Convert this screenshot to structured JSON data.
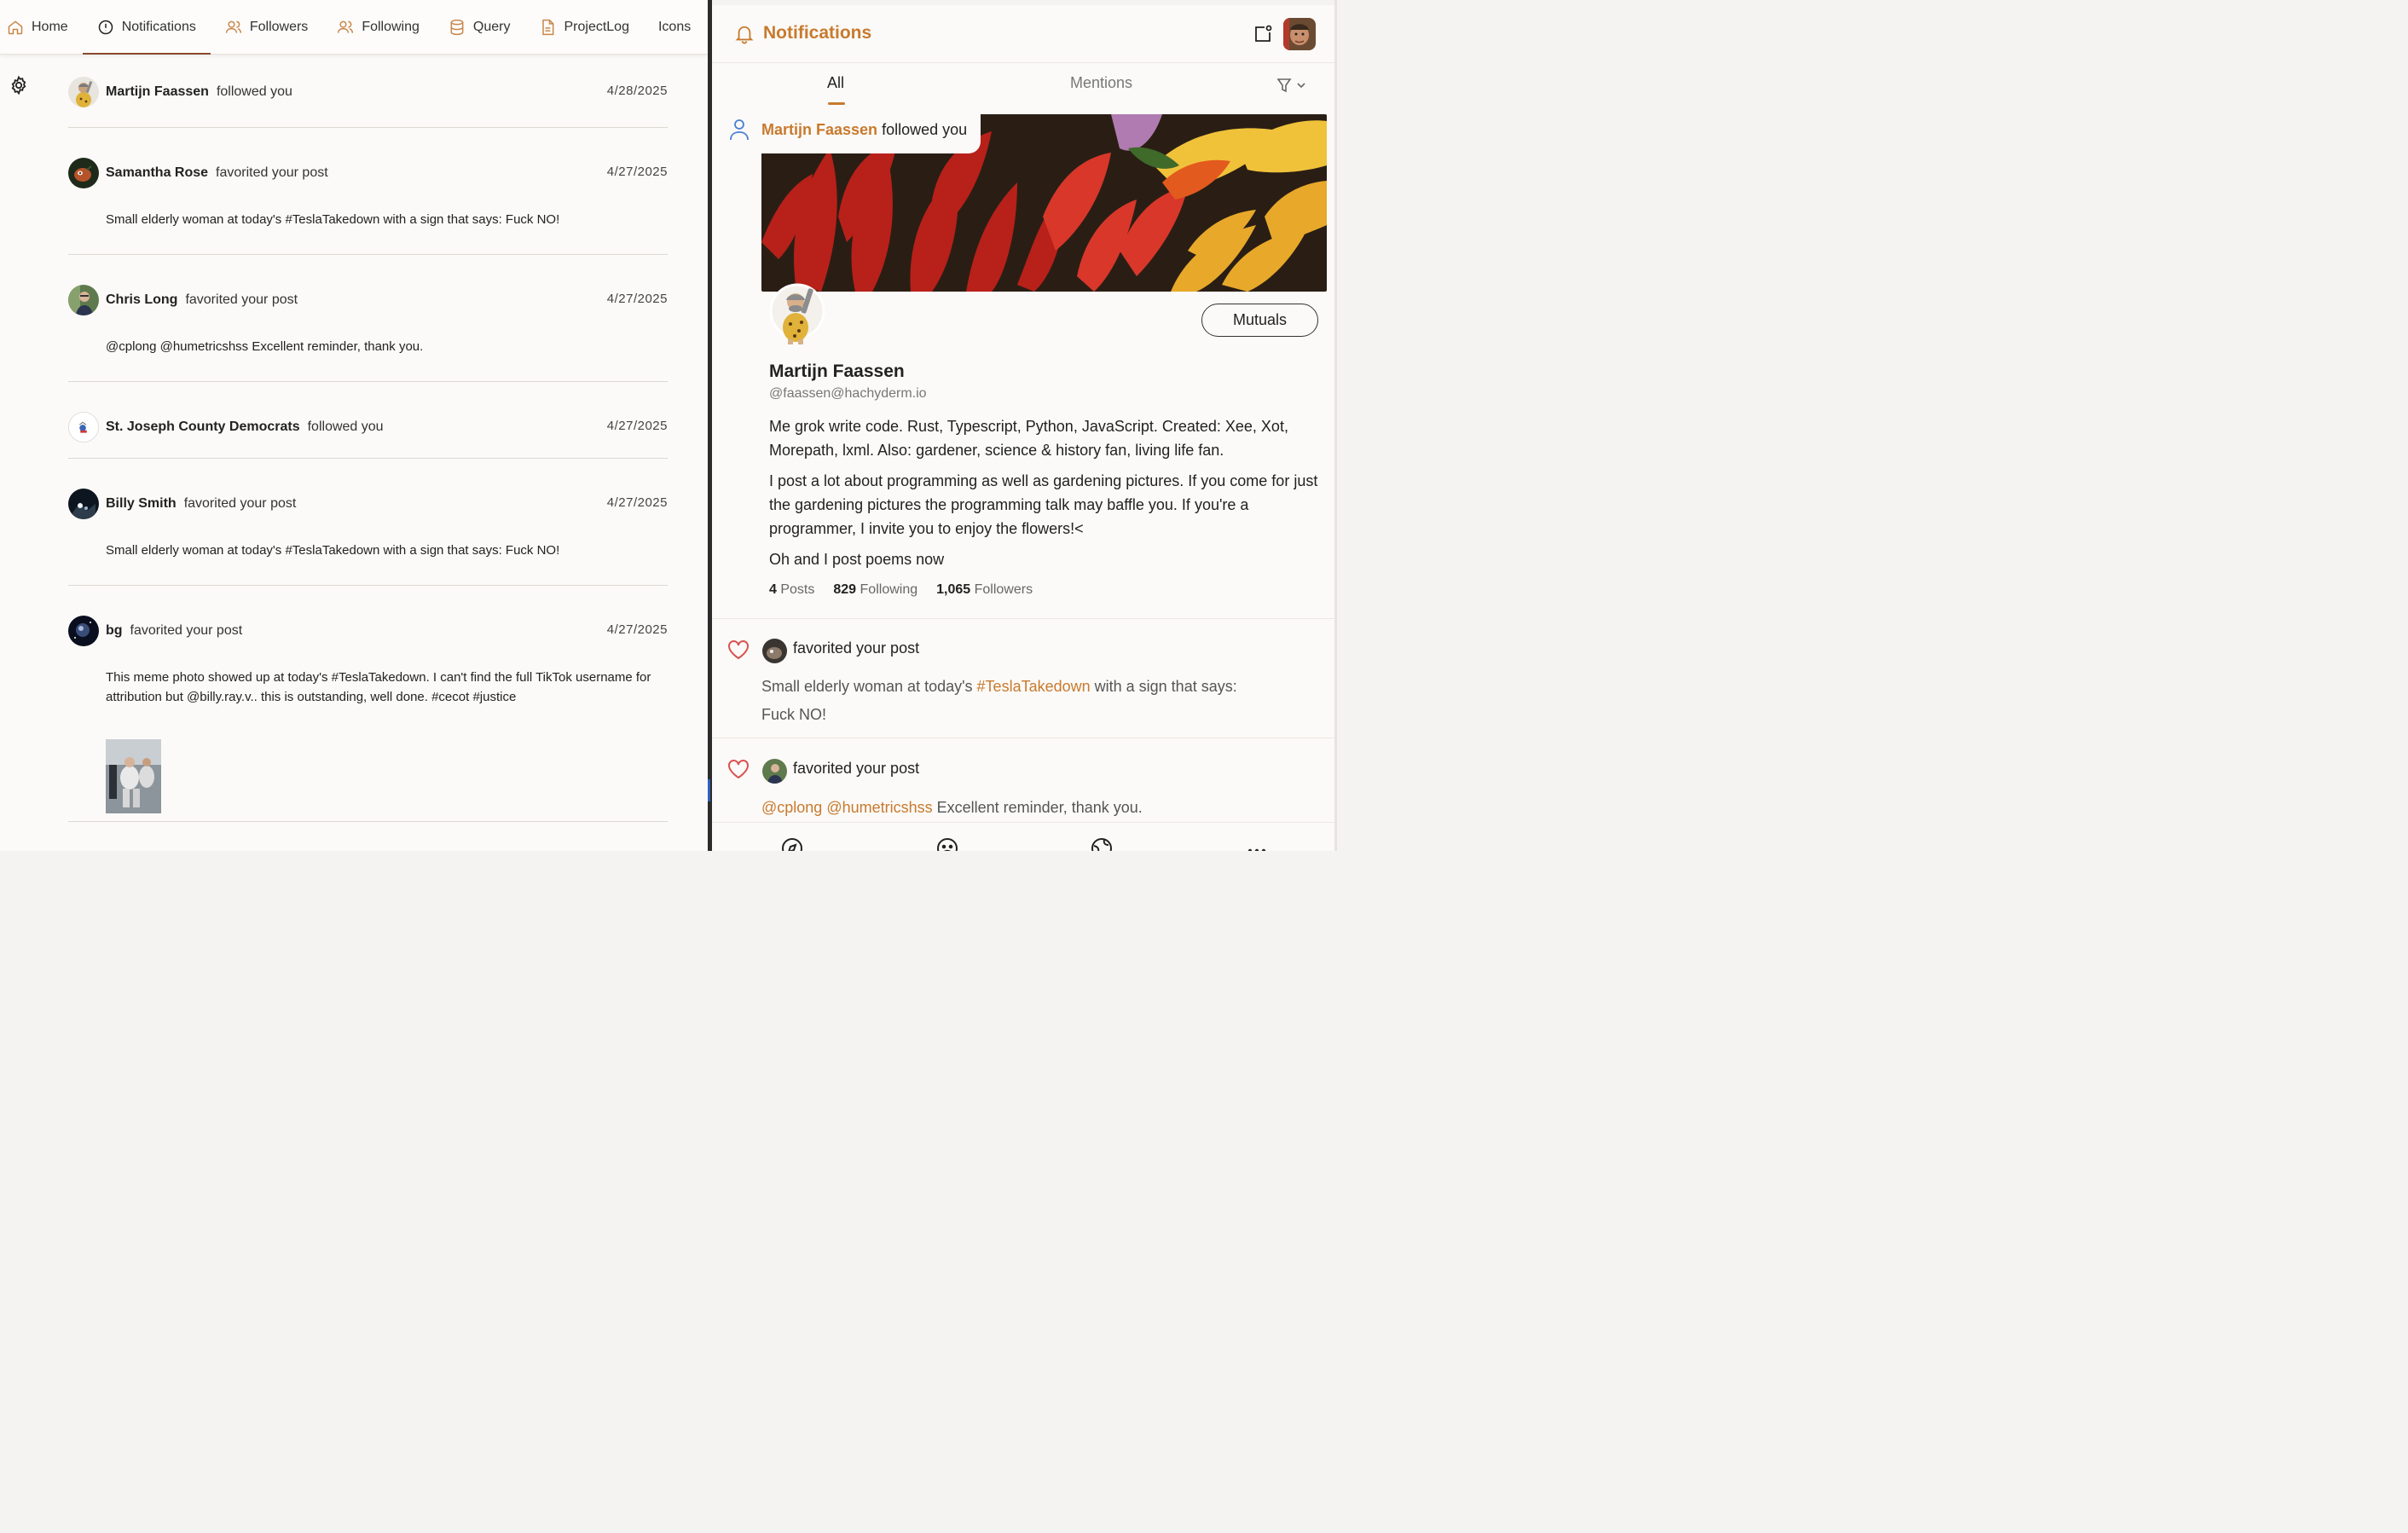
{
  "nav": {
    "tabs": [
      {
        "label": "Home",
        "icon": "home-icon"
      },
      {
        "label": "Notifications",
        "icon": "alert-circle-icon"
      },
      {
        "label": "Followers",
        "icon": "users-icon"
      },
      {
        "label": "Following",
        "icon": "users-icon"
      },
      {
        "label": "Query",
        "icon": "database-icon"
      },
      {
        "label": "ProjectLog",
        "icon": "document-icon"
      },
      {
        "label": "Icons",
        "icon": ""
      }
    ],
    "active": "Notifications"
  },
  "notifications": [
    {
      "name": "Martijn Faassen",
      "action": "followed you",
      "date": "4/28/2025",
      "text": ""
    },
    {
      "name": "Samantha Rose",
      "action": "favorited your post",
      "date": "4/27/2025",
      "text": "Small elderly woman at today's #TeslaTakedown with a sign that says: Fuck NO!"
    },
    {
      "name": "Chris Long",
      "action": "favorited your post",
      "date": "4/27/2025",
      "text": "@cplong @humetricshss Excellent reminder, thank you."
    },
    {
      "name": "St. Joseph County Democrats",
      "action": "followed you",
      "date": "4/27/2025",
      "text": ""
    },
    {
      "name": "Billy Smith",
      "action": "favorited your post",
      "date": "4/27/2025",
      "text": "Small elderly woman at today's #TeslaTakedown with a sign that says: Fuck NO!"
    },
    {
      "name": "bg",
      "action": "favorited your post",
      "date": "4/27/2025",
      "text": "This meme photo showed up at today's #TeslaTakedown. I can't find the full TikTok username for attribution but @billy.ray.v.. this is outstanding, well done. #cecot #justice"
    }
  ],
  "panel": {
    "title": "Notifications",
    "tabs": {
      "all": "All",
      "mentions": "Mentions"
    },
    "follow": {
      "name": "Martijn Faassen",
      "action": "followed you",
      "mutuals_label": "Mutuals",
      "display_name": "Martijn Faassen",
      "handle": "@faassen@hachyderm.io",
      "bio": [
        "Me grok write code. Rust, Typescript, Python, JavaScript. Created: Xee, Xot, Morepath, lxml. Also: gardener, science & history fan, living life fan.",
        "I post a lot about programming as well as gardening pictures. If you come for just the gardening pictures the programming talk may baffle you. If you're a programmer, I invite you to enjoy the flowers!<",
        "Oh and I post poems now"
      ],
      "stats": {
        "posts": "4",
        "posts_label": "Posts",
        "following": "829",
        "following_label": "Following",
        "followers": "1,065",
        "followers_label": "Followers"
      }
    },
    "favs": [
      {
        "action": "favorited your post",
        "pre": "Small elderly woman at today's ",
        "tag": "#TeslaTakedown",
        "post": " with a sign that says: Fuck NO!"
      },
      {
        "action": "favorited your post",
        "mentions": "@cplong @humetricshss",
        "post": " Excellent reminder, thank you."
      }
    ]
  },
  "colors": {
    "accent": "#c87a2e",
    "active_tab": "#8b4a2c",
    "heart": "#d9534f"
  }
}
